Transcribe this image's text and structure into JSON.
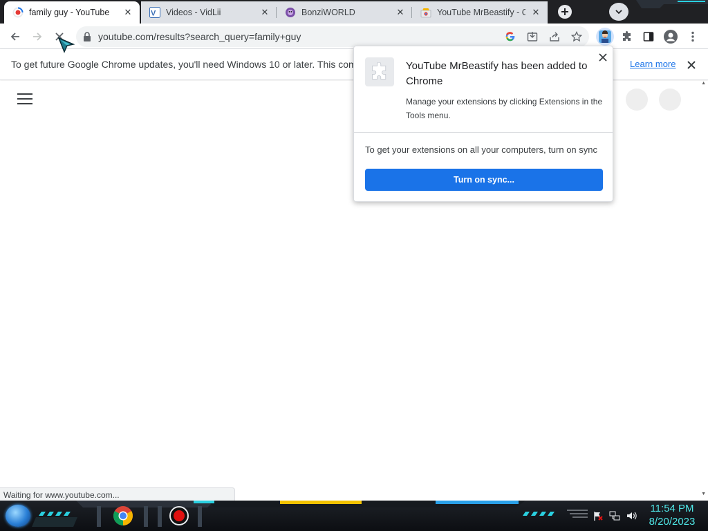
{
  "browser": {
    "tabs": [
      {
        "title": "family guy - YouTube",
        "favicon": "youtube-loading-icon",
        "active": true
      },
      {
        "title": "Videos - VidLii",
        "favicon": "vidlii-icon",
        "active": false
      },
      {
        "title": "BonziWORLD",
        "favicon": "bonziworld-icon",
        "active": false
      },
      {
        "title": "YouTube MrBeastify - Ch",
        "favicon": "chrome-webstore-icon",
        "active": false
      }
    ],
    "address_url": "youtube.com/results?search_query=family+guy"
  },
  "infobar": {
    "message": "To get future Google Chrome updates, you'll need Windows 10 or later. This computer",
    "link_label": "Learn more"
  },
  "popup": {
    "title": "YouTube MrBeastify has been added to Chrome",
    "body": "Manage your extensions by clicking Extensions in the Tools menu.",
    "sync_text": "To get your extensions on all your computers, turn on sync",
    "sync_button": "Turn on sync..."
  },
  "status_bar": {
    "text": "Waiting for www.youtube.com..."
  },
  "taskbar": {
    "time": "11:54 PM",
    "date": "8/20/2023",
    "clock_color": "#4fe6e6"
  },
  "colors": {
    "accent": "#1a73e8",
    "tabstrip": "#202124"
  }
}
